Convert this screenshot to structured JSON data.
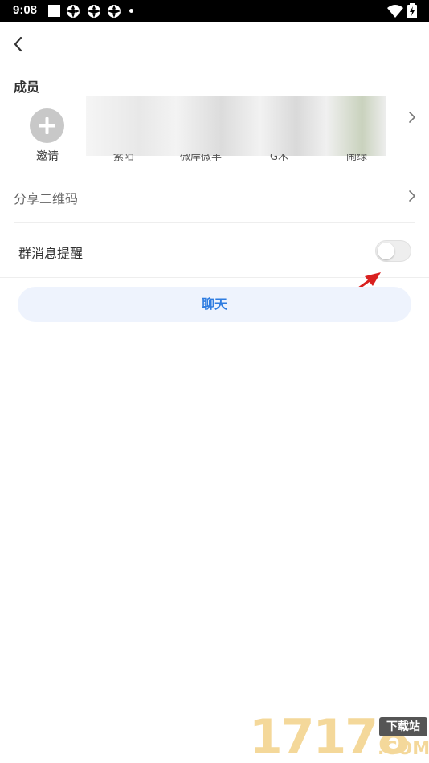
{
  "status_bar": {
    "time": "9:08"
  },
  "section": {
    "members_title": "成员"
  },
  "members": {
    "invite_label": "邀请",
    "names": [
      "紫陌",
      "微岸微羊",
      "G木",
      "闹绿"
    ]
  },
  "rows": {
    "share_qr": "分享二维码",
    "group_msg_reminder": "群消息提醒"
  },
  "toggle": {
    "state": "off"
  },
  "chat_button": {
    "label": "聊天"
  },
  "watermark": {
    "digits": "17178",
    "badge": "下载站",
    "com": ".COM"
  },
  "colors": {
    "accent": "#2f7de1",
    "button_bg": "#eef3fd",
    "arrow": "#d9201f"
  }
}
